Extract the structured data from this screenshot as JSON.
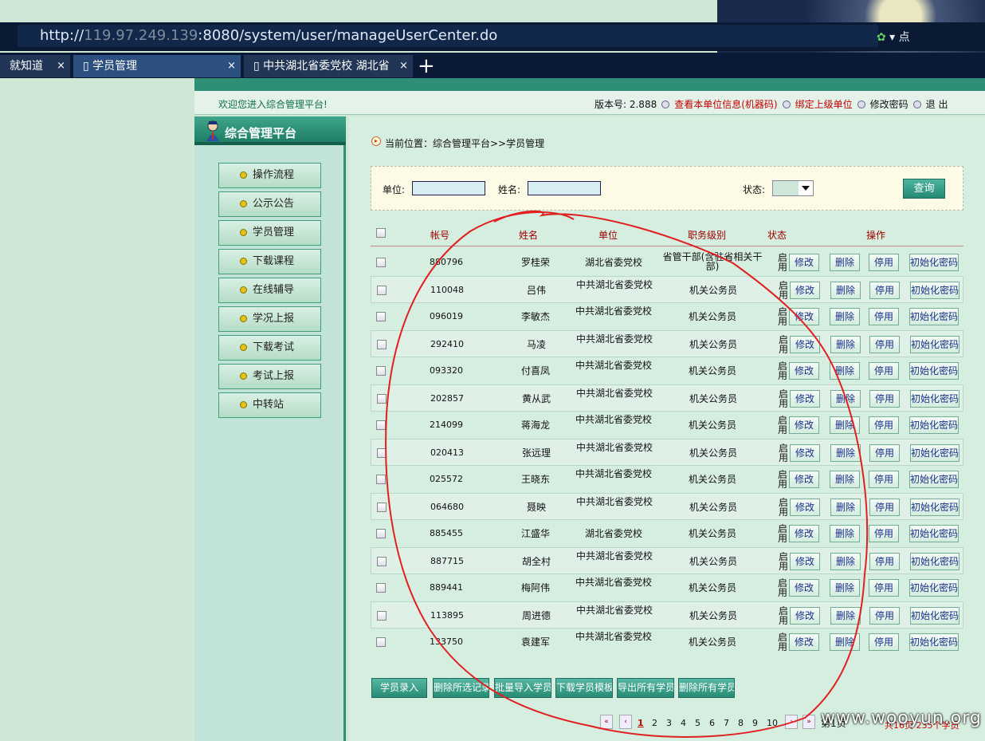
{
  "browser": {
    "url_host": "119.97.249.139",
    "url_prefix": "http://",
    "url_rest": ":8080/system/user/manageUserCenter.do",
    "toolbar_right_label": "点",
    "tabs": [
      {
        "label": "就知道"
      },
      {
        "label": "学员管理"
      },
      {
        "label": "中共湖北省委党校 湖北省"
      }
    ],
    "close_glyph": "×",
    "new_tab_glyph": "+"
  },
  "header": {
    "welcome": "欢迎您进入综合管理平台!",
    "version_label": "版本号: 2.888",
    "view_unit_info": "查看本单位信息(机器码)",
    "bind_parent": "绑定上级单位",
    "change_password": "修改密码",
    "logout": "退  出"
  },
  "sidebar": {
    "title": "综合管理平台",
    "items": [
      {
        "label": "操作流程"
      },
      {
        "label": "公示公告"
      },
      {
        "label": "学员管理"
      },
      {
        "label": "下载课程"
      },
      {
        "label": "在线辅导"
      },
      {
        "label": "学况上报"
      },
      {
        "label": "下载考试"
      },
      {
        "label": "考试上报"
      },
      {
        "label": "中转站"
      }
    ]
  },
  "breadcrumb": "当前位置：综合管理平台>>学员管理",
  "search": {
    "unit_label": "单位:",
    "name_label": "姓名:",
    "status_label": "状态:",
    "query_button": "查询"
  },
  "table": {
    "headers": {
      "account": "帐号",
      "name": "姓名",
      "unit": "单位",
      "rank": "职务级别",
      "status": "状态",
      "actions": "操作"
    },
    "action_labels": {
      "edit": "修改",
      "delete": "删除",
      "disable": "停用",
      "reset": "初始化密码"
    },
    "rows": [
      {
        "account": "880796",
        "name": "罗桂荣",
        "unit": "湖北省委党校",
        "rank": "省管干部(含驻省相关干部)",
        "status": "启用"
      },
      {
        "account": "110048",
        "name": "吕伟",
        "unit": "中共湖北省委党校",
        "rank": "机关公务员",
        "status": "启用"
      },
      {
        "account": "096019",
        "name": "李敏杰",
        "unit": "中共湖北省委党校",
        "rank": "机关公务员",
        "status": "启用"
      },
      {
        "account": "292410",
        "name": "马凌",
        "unit": "中共湖北省委党校",
        "rank": "机关公务员",
        "status": "启用"
      },
      {
        "account": "093320",
        "name": "付喜凤",
        "unit": "中共湖北省委党校",
        "rank": "机关公务员",
        "status": "启用"
      },
      {
        "account": "202857",
        "name": "黄从武",
        "unit": "中共湖北省委党校",
        "rank": "机关公务员",
        "status": "启用"
      },
      {
        "account": "214099",
        "name": "蒋海龙",
        "unit": "中共湖北省委党校",
        "rank": "机关公务员",
        "status": "启用"
      },
      {
        "account": "020413",
        "name": "张远理",
        "unit": "中共湖北省委党校",
        "rank": "机关公务员",
        "status": "启用"
      },
      {
        "account": "025572",
        "name": "王晓东",
        "unit": "中共湖北省委党校",
        "rank": "机关公务员",
        "status": "启用"
      },
      {
        "account": "064680",
        "name": "聂映",
        "unit": "中共湖北省委党校",
        "rank": "机关公务员",
        "status": "启用"
      },
      {
        "account": "885455",
        "name": "江盛华",
        "unit": "湖北省委党校",
        "rank": "机关公务员",
        "status": "启用"
      },
      {
        "account": "887715",
        "name": "胡全村",
        "unit": "中共湖北省委党校",
        "rank": "机关公务员",
        "status": "启用"
      },
      {
        "account": "889441",
        "name": "梅阿伟",
        "unit": "中共湖北省委党校",
        "rank": "机关公务员",
        "status": "启用"
      },
      {
        "account": "113895",
        "name": "周进德",
        "unit": "中共湖北省委党校",
        "rank": "机关公务员",
        "status": "启用"
      },
      {
        "account": "133750",
        "name": "袁建军",
        "unit": "中共湖北省委党校",
        "rank": "机关公务员",
        "status": "启用"
      }
    ]
  },
  "actions_bar": [
    "学员录入",
    "删除所选记录",
    "批量导入学员",
    "下载学员模板",
    "导出所有学员",
    "删除所有学员"
  ],
  "pager": {
    "pages": [
      "1",
      "2",
      "3",
      "4",
      "5",
      "6",
      "7",
      "8",
      "9",
      "10"
    ],
    "current": "1",
    "page_select": "第1页",
    "total": "共16页 235个学员"
  },
  "watermark": "www.wooyun.org",
  "colors": {
    "accent": "#2e8e76",
    "header_red": "#a00000",
    "annotation": "#e02020"
  },
  "icons": [
    "avatar-icon",
    "bullet-icon",
    "refresh-icon",
    "chevron-down-icon"
  ]
}
